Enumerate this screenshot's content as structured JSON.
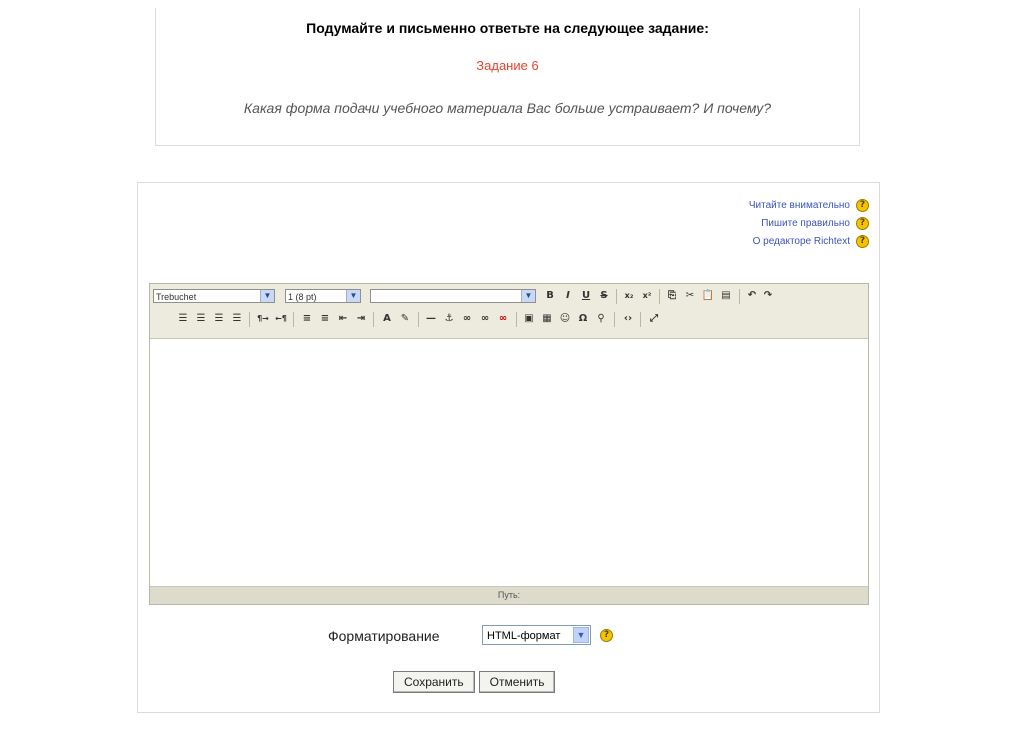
{
  "question": {
    "heading": "Подумайте и письменно ответьте на следующее задание:",
    "task_label": "Задание 6",
    "text": "Какая форма подачи учебного материала Вас больше устраивает? И почему?"
  },
  "help_links": [
    {
      "label": "Читайте внимательно"
    },
    {
      "label": "Пишите правильно"
    },
    {
      "label": "О редакторе Richtext"
    }
  ],
  "editor": {
    "font_family": "Trebuchet",
    "font_size": "1 (8 pt)",
    "paragraph_style": "",
    "path_label": "Путь:"
  },
  "format": {
    "label": "Форматирование",
    "value": "HTML-формат"
  },
  "buttons": {
    "save": "Сохранить",
    "cancel": "Отменить"
  }
}
